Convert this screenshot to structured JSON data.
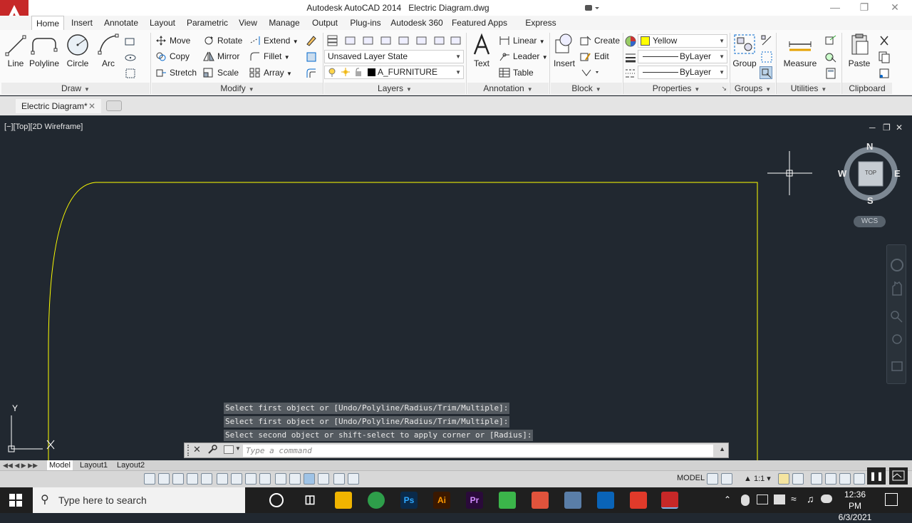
{
  "title": {
    "app": "Autodesk AutoCAD 2014",
    "file": "Electric Diagram.dwg"
  },
  "ribbon_tabs": [
    "Home",
    "Insert",
    "Annotate",
    "Layout",
    "Parametric",
    "View",
    "Manage",
    "Output",
    "Plug-ins",
    "Autodesk 360",
    "Featured Apps",
    "Express Tools"
  ],
  "active_tab": "Home",
  "draw": {
    "line": "Line",
    "polyline": "Polyline",
    "circle": "Circle",
    "arc": "Arc",
    "panel": "Draw"
  },
  "modify": {
    "move": "Move",
    "rotate": "Rotate",
    "extend": "Extend",
    "copy": "Copy",
    "mirror": "Mirror",
    "fillet": "Fillet",
    "stretch": "Stretch",
    "scale": "Scale",
    "array": "Array",
    "panel": "Modify"
  },
  "layers": {
    "state": "Unsaved Layer State",
    "current": "A_FURNITURE",
    "panel": "Layers"
  },
  "annotation": {
    "text": "Text",
    "linear": "Linear",
    "leader": "Leader",
    "table": "Table",
    "panel": "Annotation"
  },
  "block": {
    "insert": "Insert",
    "create": "Create",
    "edit": "Edit",
    "panel": "Block"
  },
  "properties": {
    "color": "Yellow",
    "color_hex": "#ffff00",
    "linetype": "ByLayer",
    "lineweight": "ByLayer",
    "panel": "Properties"
  },
  "groups": {
    "group": "Group",
    "panel": "Groups"
  },
  "utilities": {
    "measure": "Measure",
    "panel": "Utilities"
  },
  "clipboard": {
    "paste": "Paste",
    "panel": "Clipboard"
  },
  "doc_tab": {
    "label": "Electric Diagram*"
  },
  "viewport": {
    "label": "[−][Top][2D Wireframe]",
    "compass": {
      "n": "N",
      "s": "S",
      "e": "E",
      "w": "W",
      "top": "TOP"
    },
    "wcs": "WCS",
    "ucs_y": "Y"
  },
  "command": {
    "history": [
      "Select first object or [Undo/Polyline/Radius/Trim/Multiple]:",
      "Select first object or [Undo/Polyline/Radius/Trim/Multiple]:",
      "Select second object or shift-select to apply corner or [Radius]:"
    ],
    "placeholder": "Type a command"
  },
  "layout_tabs": [
    "Model",
    "Layout1",
    "Layout2"
  ],
  "status": {
    "model": "MODEL",
    "scale": "1:1"
  },
  "taskbar": {
    "search": "Type here to search",
    "time": "12:36 PM",
    "date": "6/3/2021"
  },
  "colors": {
    "viewport_bg": "#212830",
    "drawing_line": "#ffff00",
    "accent": "#c62828"
  }
}
